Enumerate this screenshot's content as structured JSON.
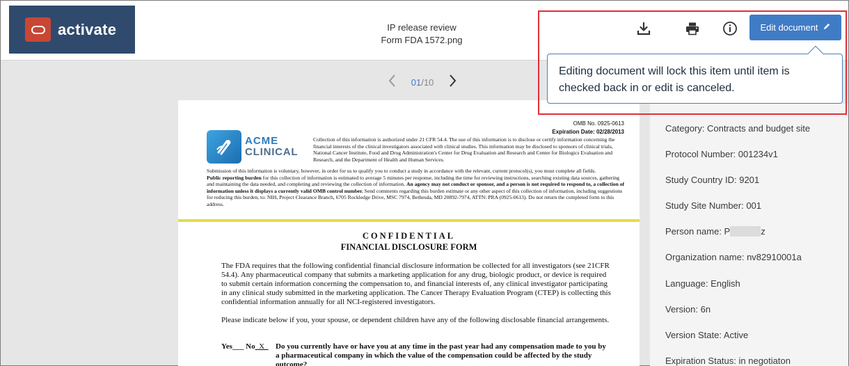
{
  "header": {
    "app_name": "activate",
    "review_title": "IP release review",
    "file_name": "Form FDA 1572.png",
    "edit_button_label": "Edit document",
    "tooltip_text": "Editing document will lock this item until item is checked back in or edit is canceled.",
    "icons": [
      "download-icon",
      "print-icon",
      "info-icon",
      "pencil-icon"
    ]
  },
  "pager": {
    "current": "01",
    "separator": "/",
    "total": "10"
  },
  "document": {
    "omb_number": "OMB No. 0925-0613",
    "expiration": "Expiration Date: 02/28/2013",
    "logo_line1": "ACME",
    "logo_line2": "CLINICAL",
    "authorization_text": "Collection of this information is authorized under 21 CFR 54.4. The use of this information is to disclose or certify information concerning the financial interests of the clinical investigators associated with clinical studies. This information may be disclosed to sponsors of clinical trials, National Cancer Institute, Food and Drug Administration's Center for Drug Evaluation and Research and Center for Biologics Evaluation and Research, and the Department of Health and Human Services.",
    "submission_text": "Submission of this information is voluntary, however, in order for us to qualify you to conduct a study in accordance with the relevant, current protocol(s), you must complete all fields.",
    "burden_label": "Public reporting burden",
    "burden_text": " for this collection of information is estimated to average 5 minutes per response, including the time for reviewing instructions, searching existing data sources, gathering and maintaining the data needed, and completing and reviewing the collection of information. ",
    "burden_bold": "An agency may not conduct or sponsor, and a person is not required to respond to, a collection of information unless it displays a currently valid OMB control number.",
    "burden_tail": " Send comments regarding this burden estimate or any other aspect of this collection of information, including suggestions for reducing this burden, to: NIH, Project Clearance Branch, 6705 Rockledge Drive, MSC 7974, Bethesda, MD 20892-7974, ATTN: PRA (0925-0613). Do not return the completed form to this address.",
    "confidential_title": "CONFIDENTIAL",
    "form_title": "FINANCIAL DISCLOSURE FORM",
    "body_paragraph": "The FDA requires that the following confidential financial disclosure information be collected for all investigators (see 21CFR 54.4). Any pharmaceutical company that submits a marketing application for any drug, biologic product, or device is required to submit certain information concerning the compensation to, and financial interests of, any clinical investigator participating in any clinical study submitted in the marketing application. The Cancer Therapy Evaluation Program (CTEP) is collecting this confidential information annually for all NCI-registered investigators.",
    "indicate_paragraph": "Please indicate below if you, your spouse, or dependent children have any of the following disclosable financial arrangements.",
    "yes_label": "Yes___ No",
    "no_mark": "_X_",
    "question_1": "Do you currently have or have you at any time in the past year had any compensation made to you by a pharmaceutical company in which the value of the compensation could be affected by the study outcome?"
  },
  "metadata": {
    "category": "Category: Contracts and budget site",
    "protocol_number": "Protocol Number: 001234v1",
    "study_country_id": "Study Country ID: 9201",
    "study_site_number": "Study Site Number: 001",
    "person_name_prefix": "Person name: P",
    "person_name_suffix": "z",
    "organization_name": "Organization name: nv82910001a",
    "language": "Language: English",
    "version": "Version: 6n",
    "version_state": "Version State: Active",
    "expiration_status": "Expiration Status: in negotiaton"
  },
  "colors": {
    "brand_navy": "#2f4a6d",
    "brand_red": "#c74634",
    "primary_button": "#3f7cc5",
    "highlight_red": "#e0303a"
  }
}
